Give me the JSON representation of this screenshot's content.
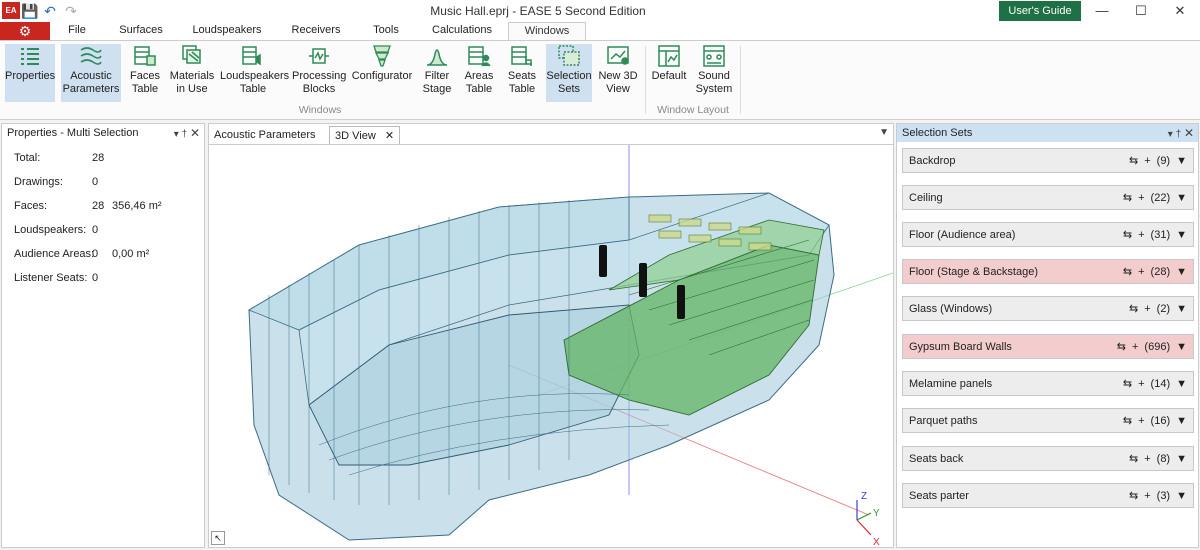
{
  "window": {
    "title": "Music Hall.eprj - EASE 5 Second Edition",
    "users_guide": "User's Guide",
    "logo": "EA",
    "controls": [
      "—",
      "☐",
      "✕"
    ]
  },
  "menu_tabs": [
    "File",
    "Surfaces",
    "Loudspeakers",
    "Receivers",
    "Tools",
    "Calculations",
    "Windows"
  ],
  "active_tab": "Windows",
  "ribbon": {
    "groups": [
      "Windows",
      "Window Layout"
    ],
    "buttons": [
      {
        "label1": "Properties",
        "label2": "",
        "icon": "properties-icon",
        "selected": true
      },
      {
        "label1": "Acoustic",
        "label2": "Parameters",
        "icon": "acoustic-parameters-icon",
        "selected": true
      },
      {
        "label1": "Faces",
        "label2": "Table",
        "icon": "faces-table-icon",
        "selected": false
      },
      {
        "label1": "Materials",
        "label2": "in Use",
        "icon": "materials-icon",
        "selected": false
      },
      {
        "label1": "Loudspeakers",
        "label2": "Table",
        "icon": "loudspeakers-table-icon",
        "selected": false
      },
      {
        "label1": "Processing",
        "label2": "Blocks",
        "icon": "processing-blocks-icon",
        "selected": false
      },
      {
        "label1": "Configurator",
        "label2": "",
        "icon": "configurator-icon",
        "selected": false
      },
      {
        "label1": "Filter",
        "label2": "Stage",
        "icon": "filter-stage-icon",
        "selected": false
      },
      {
        "label1": "Areas",
        "label2": "Table",
        "icon": "areas-table-icon",
        "selected": false
      },
      {
        "label1": "Seats",
        "label2": "Table",
        "icon": "seats-table-icon",
        "selected": false
      },
      {
        "label1": "Selection",
        "label2": "Sets",
        "icon": "selection-sets-icon",
        "selected": true
      },
      {
        "label1": "New 3D",
        "label2": "View",
        "icon": "new-3d-view-icon",
        "selected": false
      },
      {
        "label1": "Default",
        "label2": "",
        "icon": "default-layout-icon",
        "selected": false
      },
      {
        "label1": "Sound",
        "label2": "System",
        "icon": "sound-system-icon",
        "selected": false
      }
    ]
  },
  "properties": {
    "title": "Properties - Multi Selection",
    "rows": [
      {
        "label": "Total:",
        "value": "28",
        "extra": ""
      },
      {
        "label": "Drawings:",
        "value": "0",
        "extra": ""
      },
      {
        "label": "Faces:",
        "value": "28",
        "extra": "356,46 m²"
      },
      {
        "label": "Loudspeakers:",
        "value": "0",
        "extra": ""
      },
      {
        "label": "Audience Areas:",
        "value": "0",
        "extra": "0,00 m²"
      },
      {
        "label": "Listener Seats:",
        "value": "0",
        "extra": ""
      }
    ]
  },
  "center_tabs": [
    {
      "label": "Acoustic Parameters",
      "active": false
    },
    {
      "label": "3D View",
      "active": true
    }
  ],
  "viewport": {
    "axes": [
      "X",
      "Y",
      "Z"
    ],
    "colors": {
      "hall": "#9ec9dc",
      "hall_stroke": "#3b6c82",
      "stage": "#63b463",
      "stage_stroke": "#2f6b2f"
    }
  },
  "selection_sets": {
    "title": "Selection Sets",
    "items": [
      {
        "name": "Backdrop",
        "count": "(9)",
        "highlighted": false
      },
      {
        "name": "Ceiling",
        "count": "(22)",
        "highlighted": false
      },
      {
        "name": "Floor (Audience area)",
        "count": "(31)",
        "highlighted": false
      },
      {
        "name": "Floor (Stage & Backstage)",
        "count": "(28)",
        "highlighted": true
      },
      {
        "name": "Glass (Windows)",
        "count": "(2)",
        "highlighted": false
      },
      {
        "name": "Gypsum Board Walls",
        "count": "(696)",
        "highlighted": true
      },
      {
        "name": "Melamine panels",
        "count": "(14)",
        "highlighted": false
      },
      {
        "name": "Parquet paths",
        "count": "(16)",
        "highlighted": false
      },
      {
        "name": "Seats back",
        "count": "(8)",
        "highlighted": false
      },
      {
        "name": "Seats parter",
        "count": "(3)",
        "highlighted": false
      }
    ]
  }
}
